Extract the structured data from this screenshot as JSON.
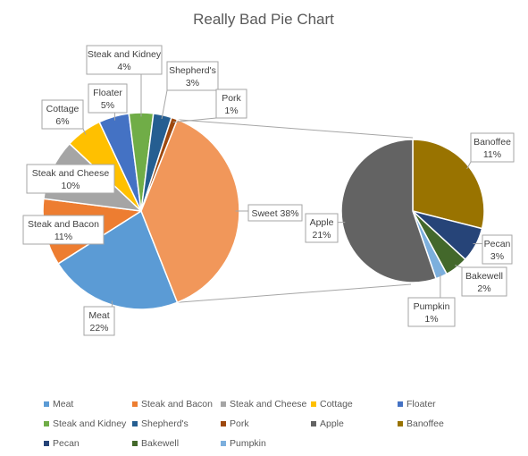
{
  "chart_data": {
    "type": "pie",
    "subtype": "bar-of-pie (pie of pie)",
    "title": "Really Bad Pie Chart",
    "primary": [
      {
        "name": "Meat",
        "value": 22,
        "label": "Meat\n22%",
        "color": "#5B9BD5"
      },
      {
        "name": "Steak and Bacon",
        "value": 11,
        "label": "Steak and Bacon\n11%",
        "color": "#ED7D31"
      },
      {
        "name": "Steak and Cheese",
        "value": 10,
        "label": "Steak and Cheese\n10%",
        "color": "#A5A5A5"
      },
      {
        "name": "Cottage",
        "value": 6,
        "label": "Cottage\n6%",
        "color": "#FFC000"
      },
      {
        "name": "Floater",
        "value": 5,
        "label": "Floater\n5%",
        "color": "#4472C4"
      },
      {
        "name": "Steak and Kidney",
        "value": 4,
        "label": "Steak and Kidney\n4%",
        "color": "#70AD47"
      },
      {
        "name": "Shepherd's",
        "value": 3,
        "label": "Shepherd's\n3%",
        "color": "#255E91"
      },
      {
        "name": "Pork",
        "value": 1,
        "label": "Pork\n1%",
        "color": "#9E480E"
      },
      {
        "name": "Sweet",
        "value": 38,
        "label": "Sweet 38%",
        "color": "#F1975A"
      }
    ],
    "secondary": [
      {
        "name": "Banoffee",
        "value": 11,
        "label": "Banoffee\n11%",
        "color": "#997300"
      },
      {
        "name": "Pecan",
        "value": 3,
        "label": "Pecan\n3%",
        "color": "#264478"
      },
      {
        "name": "Bakewell",
        "value": 2,
        "label": "Bakewell\n2%",
        "color": "#43682B"
      },
      {
        "name": "Pumpkin",
        "value": 1,
        "label": "Pumpkin\n1%",
        "color": "#7CAFDD"
      },
      {
        "name": "Apple",
        "value": 21,
        "label": "Apple\n21%",
        "color": "#636363"
      }
    ],
    "legend": {
      "placement": "bottom",
      "entries": [
        {
          "name": "Meat",
          "color": "#5B9BD5"
        },
        {
          "name": "Steak and Bacon",
          "color": "#ED7D31"
        },
        {
          "name": "Steak and Cheese",
          "color": "#A5A5A5"
        },
        {
          "name": "Cottage",
          "color": "#FFC000"
        },
        {
          "name": "Floater",
          "color": "#4472C4"
        },
        {
          "name": "Steak and Kidney",
          "color": "#70AD47"
        },
        {
          "name": "Shepherd's",
          "color": "#255E91"
        },
        {
          "name": "Pork",
          "color": "#9E480E"
        },
        {
          "name": "Apple",
          "color": "#636363"
        },
        {
          "name": "Banoffee",
          "color": "#997300"
        },
        {
          "name": "Pecan",
          "color": "#264478"
        },
        {
          "name": "Bakewell",
          "color": "#43682B"
        },
        {
          "name": "Pumpkin",
          "color": "#7CAFDD"
        }
      ]
    }
  }
}
